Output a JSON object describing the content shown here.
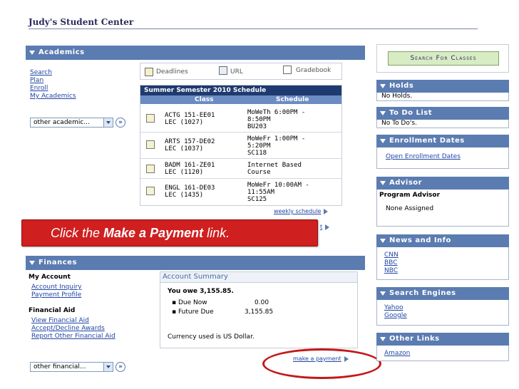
{
  "page": {
    "title": "Judy's Student Center"
  },
  "academics": {
    "header": "Academics",
    "links": [
      "Search",
      "Plan",
      "Enroll",
      "My Academics"
    ],
    "select_value": "other academic...",
    "tabs": [
      "Deadlines",
      "URL",
      "Gradebook"
    ],
    "schedule_title": "Summer Semester 2010 Schedule",
    "columns": [
      "Class",
      "Schedule"
    ],
    "rows": [
      {
        "class_line1": "ACTG 151-EE01",
        "class_line2": "LEC (1027)",
        "sched": [
          "MoWeTh 6:00PM -",
          "8:50PM",
          "BU203"
        ]
      },
      {
        "class_line1": "ARTS 157-DE02",
        "class_line2": "LEC (1037)",
        "sched": [
          "MoWeFr 1:00PM -",
          "5:20PM",
          "SC118"
        ]
      },
      {
        "class_line1": "BADM 161-ZE01",
        "class_line2": "LEC (1120)",
        "sched": [
          "Internet Based",
          "Course",
          ""
        ]
      },
      {
        "class_line1": "ENGL 161-DE03",
        "class_line2": "LEC (1435)",
        "sched": [
          "MoWeFr 10:00AM -",
          "11:55AM",
          "SC125"
        ]
      }
    ],
    "weekly_schedule": "weekly schedule",
    "shopping_cart_fragment": "t"
  },
  "callout": {
    "prefix": "Click the ",
    "bold": "Make a Payment",
    "suffix": " link."
  },
  "finances": {
    "header": "Finances",
    "my_account_label": "My Account",
    "my_account_links": [
      "Account Inquiry",
      "Payment Profile"
    ],
    "financial_aid_label": "Financial Aid",
    "financial_aid_links": [
      "View Financial Aid",
      "Accept/Decline Awards",
      "Report Other Financial Aid"
    ],
    "select_value": "other financial...",
    "account_summary": {
      "title": "Account Summary",
      "owe": "You owe 3,155.85.",
      "items": [
        {
          "label": "Due Now",
          "amount": "0.00"
        },
        {
          "label": "Future Due",
          "amount": "3,155.85"
        }
      ],
      "currency_note": "Currency used is US Dollar."
    },
    "make_payment": "make a payment"
  },
  "right": {
    "search_button": "Search For Classes",
    "holds": {
      "header": "Holds",
      "body": "No Holds."
    },
    "todo": {
      "header": "To Do List",
      "body": "No To Do's."
    },
    "enrollment": {
      "header": "Enrollment Dates",
      "link": "Open Enrollment Dates"
    },
    "advisor": {
      "header": "Advisor",
      "label": "Program Advisor",
      "value": "None Assigned"
    },
    "news": {
      "header": "News and Info",
      "links": [
        "CNN",
        "BBC",
        "NBC"
      ]
    },
    "search_engines": {
      "header": "Search Engines",
      "links": [
        "Yahoo",
        "Google"
      ]
    },
    "other_links": {
      "header": "Other Links",
      "links": [
        "Amazon"
      ]
    }
  },
  "colors": {
    "header_blue": "#5b7cb1",
    "callout_red": "#cf1f1f",
    "button_green": "#d8ecc4",
    "link_blue": "#2146a3"
  }
}
